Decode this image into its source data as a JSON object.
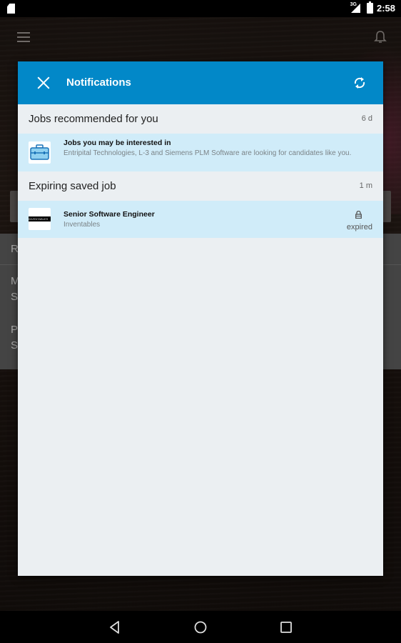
{
  "status_bar": {
    "network": "3G",
    "time": "2:58"
  },
  "background": {
    "list_rows": [
      "R",
      "M\nS",
      "P\nS"
    ]
  },
  "dialog": {
    "title": "Notifications",
    "close_icon": "close-icon",
    "refresh_icon": "refresh-icon",
    "sections": [
      {
        "title": "Jobs recommended for you",
        "time": "6 d",
        "notification": {
          "icon": "briefcase-icon",
          "title": "Jobs you may be interested in",
          "subtitle": "Entripital Technologies, L-3 and Siemens PLM Software are looking for candidates like you."
        }
      },
      {
        "title": "Expiring saved job",
        "time": "1 m",
        "notification": {
          "icon": "company-logo",
          "logo_text": "INVENTABLES",
          "title": "Senior Software Engineer",
          "subtitle": "Inventables",
          "status_icon": "lock-icon",
          "status": "expired"
        }
      }
    ]
  },
  "colors": {
    "header": "#0288c8",
    "notification_bg": "#d0ecf9",
    "dialog_bg": "#ebeff2"
  },
  "nav_bar": {
    "back": "back-icon",
    "home": "home-icon",
    "recents": "recents-icon"
  }
}
